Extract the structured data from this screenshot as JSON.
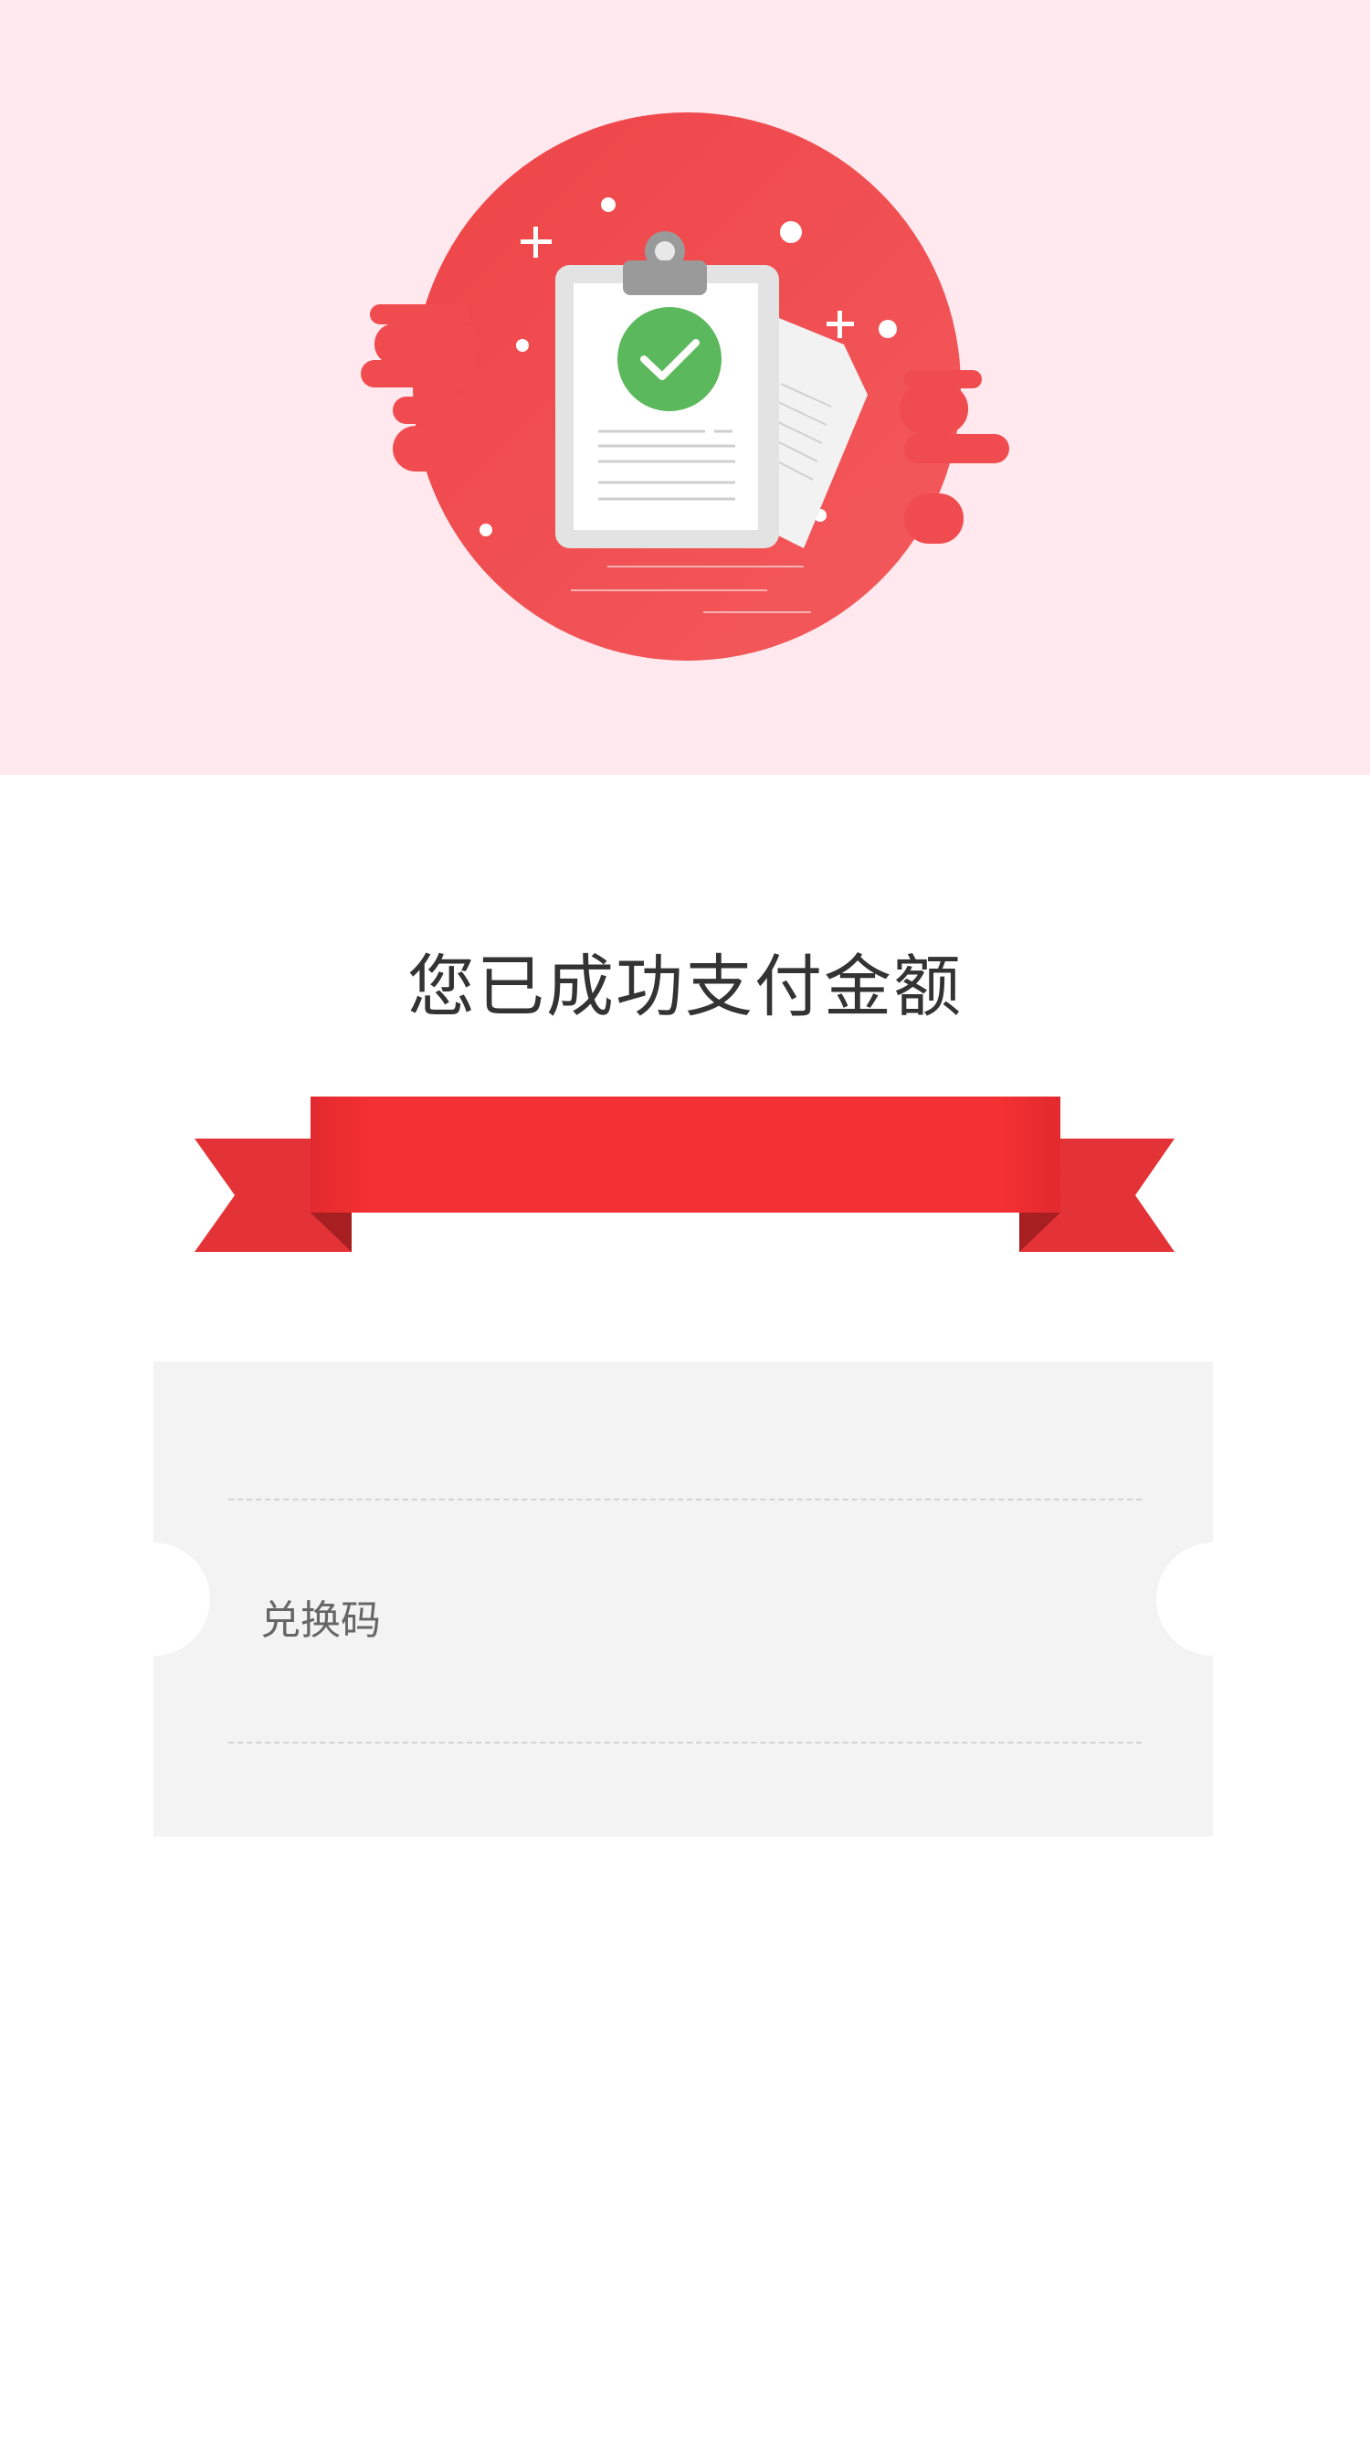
{
  "colors": {
    "hero_background": "#ffe9ee",
    "accent_red": "#f03a3e",
    "success_green": "#5cb85c",
    "ticket_background": "#f3f3f3"
  },
  "icons": {
    "hero": "clipboard-check-icon",
    "banner": "red-ribbon"
  },
  "status": {
    "title": "您已成功支付金额"
  },
  "ticket": {
    "code_label": "兑换码"
  }
}
